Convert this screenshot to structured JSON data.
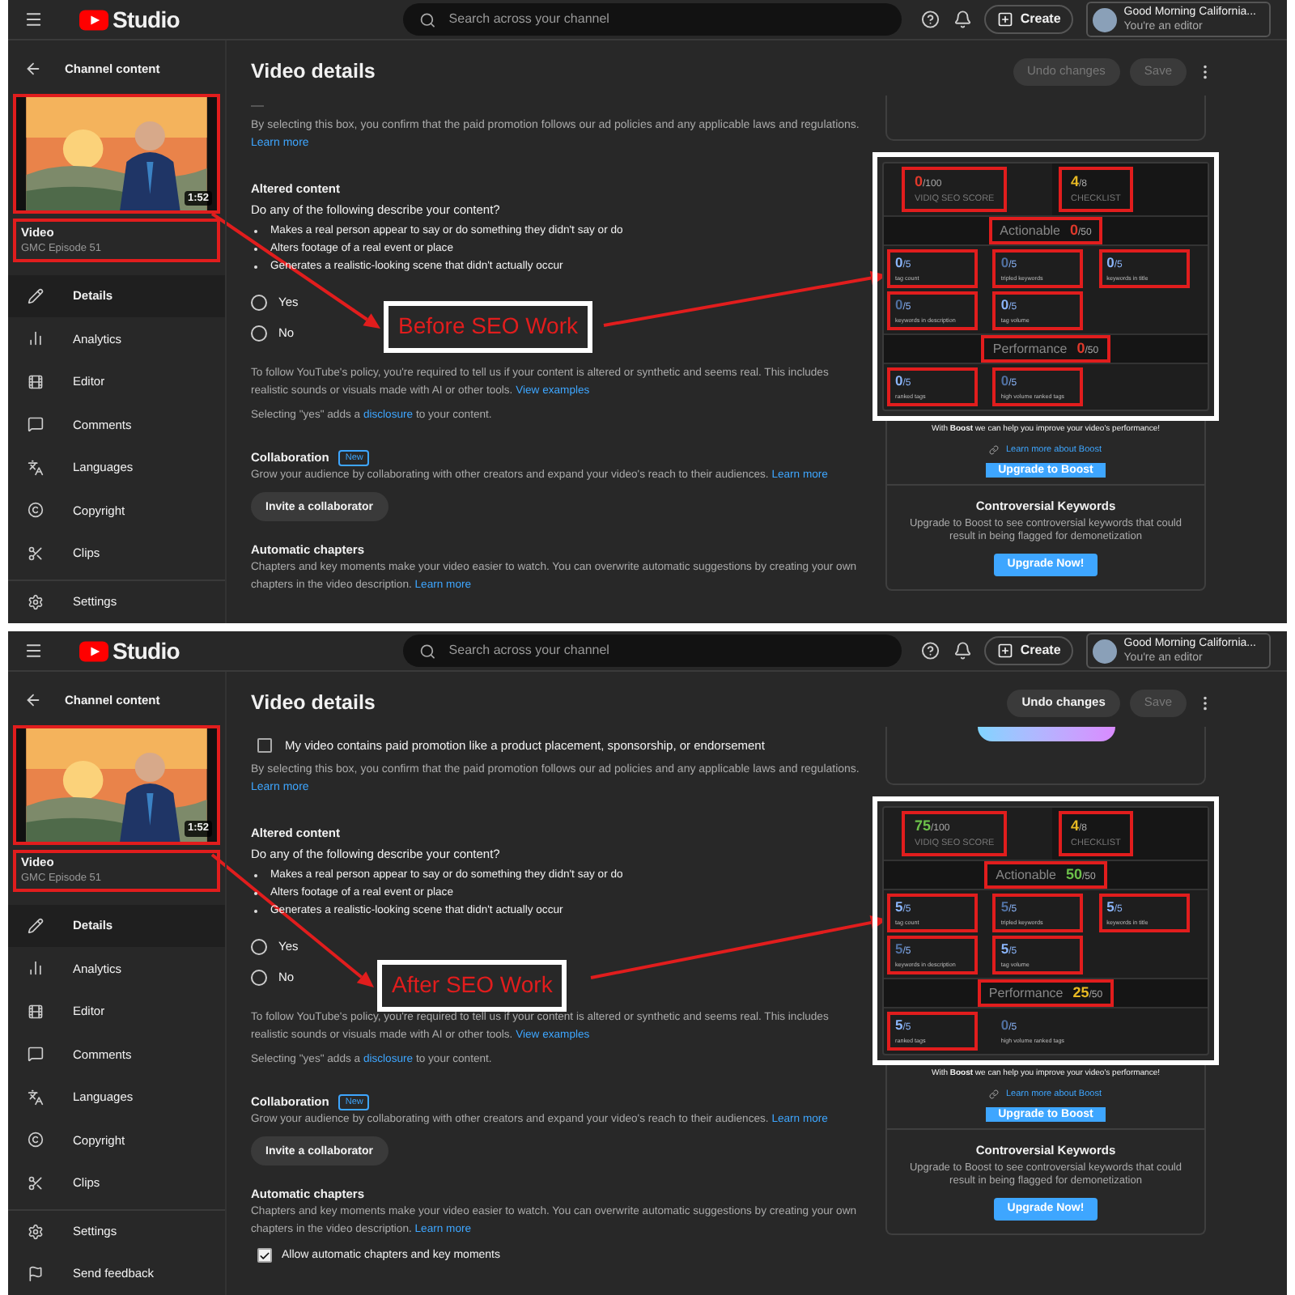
{
  "panels": [
    {
      "header": {
        "logo_text": "Studio",
        "search_placeholder": "Search across your channel",
        "create": "Create",
        "account_name": "Good Morning California...",
        "account_role": "You're an editor"
      },
      "sidebar": {
        "back": "Channel content",
        "duration": "1:52",
        "video_label": "Video",
        "video_name": "GMC Episode 51",
        "items": [
          {
            "label": "Details",
            "selected": true
          },
          {
            "label": "Analytics",
            "selected": false
          },
          {
            "label": "Editor",
            "selected": false
          },
          {
            "label": "Comments",
            "selected": false
          },
          {
            "label": "Languages",
            "selected": false
          },
          {
            "label": "Copyright",
            "selected": false
          },
          {
            "label": "Clips",
            "selected": false
          }
        ],
        "footer_items": [
          {
            "label": "Settings"
          }
        ]
      },
      "main": {
        "title": "Video details",
        "undo": {
          "label": "Undo changes",
          "disabled": true
        },
        "save": {
          "label": "Save",
          "disabled": true
        },
        "paid_note": "By selecting this box, you confirm that the paid promotion follows our ad policies and any applicable laws and regulations.",
        "paid_note_link": "Learn more",
        "altered": {
          "title": "Altered content",
          "question": "Do any of the following describe your content?",
          "bullets": [
            "Makes a real person appear to say or do something they didn't say or do",
            "Alters footage of a real event or place",
            "Generates a realistic-looking scene that didn't actually occur"
          ],
          "options": [
            {
              "label": "Yes",
              "selected": false
            },
            {
              "label": "No",
              "selected": false
            }
          ],
          "policy": "To follow YouTube's policy, you're required to tell us if your content is altered or synthetic and seems real. This includes realistic sounds or visuals made with AI or other tools.",
          "policy_link": "View examples",
          "disclosure_before": "Selecting \"yes\" adds a",
          "disclosure_link": "disclosure",
          "disclosure_after": "to your content."
        },
        "collaboration": {
          "title": "Collaboration",
          "badge": "New",
          "text": "Grow your audience by collaborating with other creators and expand your video's reach to their audiences.",
          "link": "Learn more",
          "button": "Invite a collaborator"
        },
        "chapters": {
          "title": "Automatic chapters",
          "text": "Chapters and key moments make your video easier to watch. You can overwrite automatic suggestions by creating your own chapters in the video description.",
          "link": "Learn more"
        }
      },
      "widget": {
        "top_card": {
          "kind": "card_end"
        },
        "score": {
          "value": "0",
          "total": "/100",
          "label": "VIDIQ SEO SCORE",
          "color": "#e0392b",
          "boxed": true
        },
        "checklist": {
          "value": "4",
          "total": "/8",
          "label": "CHECKLIST",
          "color": "#e8b923",
          "boxed": true
        },
        "sections": [
          {
            "title": "Actionable",
            "value": "0",
            "total": "/50",
            "color": "#e0392b",
            "boxed": true,
            "metrics": [
              {
                "value": "0",
                "total": "/5",
                "label": "tag count",
                "color": "#8ab4f8",
                "boxed": true
              },
              {
                "value": "0",
                "total": "/5",
                "label": "tripled keywords",
                "color": "#4f6f9f",
                "boxed": true
              },
              {
                "value": "0",
                "total": "/5",
                "label": "keywords in title",
                "color": "#8ab4f8",
                "boxed": true
              },
              {
                "value": "0",
                "total": "/5",
                "label": "keywords in description",
                "color": "#4f6f9f",
                "boxed": true
              },
              {
                "value": "0",
                "total": "/5",
                "label": "tag volume",
                "color": "#8ab4f8",
                "boxed": true
              }
            ]
          },
          {
            "title": "Performance",
            "value": "0",
            "total": "/50",
            "color": "#e0392b",
            "boxed": true,
            "metrics": [
              {
                "value": "0",
                "total": "/5",
                "label": "ranked tags",
                "color": "#8ab4f8",
                "boxed": true
              },
              {
                "value": "0",
                "total": "/5",
                "label": "high volume ranked tags",
                "color": "#4f6f9f",
                "boxed": true
              }
            ]
          }
        ],
        "boost_text": "With **Boost** we can help you improve your video's performance!",
        "boost_link": "Learn more about Boost",
        "boost_button": "Upgrade to Boost",
        "controversial_title": "Controversial Keywords",
        "controversial_text": "Upgrade to Boost to see controversial keywords that could result in being flagged for demonetization",
        "upgrade_button": "Upgrade Now!"
      },
      "annotation": {
        "label": "Before SEO Work",
        "highlight_video": true
      }
    },
    {
      "header": {
        "logo_text": "Studio",
        "search_placeholder": "Search across your channel",
        "create": "Create",
        "account_name": "Good Morning California...",
        "account_role": "You're an editor"
      },
      "sidebar": {
        "back": "Channel content",
        "duration": "1:52",
        "video_label": "Video",
        "video_name": "GMC Episode 51",
        "items": [
          {
            "label": "Details",
            "selected": true
          },
          {
            "label": "Analytics",
            "selected": false
          },
          {
            "label": "Editor",
            "selected": false
          },
          {
            "label": "Comments",
            "selected": false
          },
          {
            "label": "Languages",
            "selected": false
          },
          {
            "label": "Copyright",
            "selected": false
          },
          {
            "label": "Clips",
            "selected": false
          }
        ],
        "footer_items": [
          {
            "label": "Settings"
          },
          {
            "label": "Send feedback"
          }
        ]
      },
      "main": {
        "title": "Video details",
        "undo": {
          "label": "Undo changes",
          "disabled": false
        },
        "save": {
          "label": "Save",
          "disabled": true
        },
        "paid_promotion": {
          "label": "My video contains paid promotion like a product placement, sponsorship, or endorsement",
          "checked": false
        },
        "paid_note": "By selecting this box, you confirm that the paid promotion follows our ad policies and any applicable laws and regulations.",
        "paid_note_link": "Learn more",
        "altered": {
          "title": "Altered content",
          "question": "Do any of the following describe your content?",
          "bullets": [
            "Makes a real person appear to say or do something they didn't say or do",
            "Alters footage of a real event or place",
            "Generates a realistic-looking scene that didn't actually occur"
          ],
          "options": [
            {
              "label": "Yes",
              "selected": false
            },
            {
              "label": "No",
              "selected": false
            }
          ],
          "policy": "To follow YouTube's policy, you're required to tell us if your content is altered or synthetic and seems real. This includes realistic sounds or visuals made with AI or other tools.",
          "policy_link": "View examples",
          "disclosure_before": "Selecting \"yes\" adds a",
          "disclosure_link": "disclosure",
          "disclosure_after": "to your content."
        },
        "collaboration": {
          "title": "Collaboration",
          "badge": "New",
          "text": "Grow your audience by collaborating with other creators and expand your video's reach to their audiences.",
          "link": "Learn more",
          "button": "Invite a collaborator"
        },
        "chapters": {
          "title": "Automatic chapters",
          "text": "Chapters and key moments make your video easier to watch. You can overwrite automatic suggestions by creating your own chapters in the video description.",
          "link": "Learn more",
          "checkbox": {
            "label": "Allow automatic chapters and key moments",
            "checked": true
          }
        }
      },
      "widget": {
        "top_card": {
          "kind": "gradient_pill"
        },
        "score": {
          "value": "75",
          "total": "/100",
          "label": "VIDIQ SEO SCORE",
          "color": "#6cc04a",
          "boxed": true
        },
        "checklist": {
          "value": "4",
          "total": "/8",
          "label": "CHECKLIST",
          "color": "#e8b923",
          "boxed": true
        },
        "sections": [
          {
            "title": "Actionable",
            "value": "50",
            "total": "/50",
            "color": "#6cc04a",
            "boxed": true,
            "metrics": [
              {
                "value": "5",
                "total": "/5",
                "label": "tag count",
                "color": "#8ab4f8",
                "boxed": true
              },
              {
                "value": "5",
                "total": "/5",
                "label": "tripled keywords",
                "color": "#4f6f9f",
                "boxed": true
              },
              {
                "value": "5",
                "total": "/5",
                "label": "keywords in title",
                "color": "#8ab4f8",
                "boxed": true
              },
              {
                "value": "5",
                "total": "/5",
                "label": "keywords in description",
                "color": "#4f6f9f",
                "boxed": true
              },
              {
                "value": "5",
                "total": "/5",
                "label": "tag volume",
                "color": "#8ab4f8",
                "boxed": true
              }
            ]
          },
          {
            "title": "Performance",
            "value": "25",
            "total": "/50",
            "color": "#e8b923",
            "boxed": true,
            "metrics": [
              {
                "value": "5",
                "total": "/5",
                "label": "ranked tags",
                "color": "#8ab4f8",
                "boxed": true
              },
              {
                "value": "0",
                "total": "/5",
                "label": "high volume ranked tags",
                "color": "#4f6f9f",
                "boxed": false
              }
            ]
          }
        ],
        "boost_text": "With **Boost** we can help you improve your video's performance!",
        "boost_link": "Learn more about Boost",
        "boost_button": "Upgrade to Boost",
        "controversial_title": "Controversial Keywords",
        "controversial_text": "Upgrade to Boost to see controversial keywords that could result in being flagged for demonetization",
        "upgrade_button": "Upgrade Now!"
      },
      "annotation": {
        "label": "After SEO Work",
        "highlight_video": true
      }
    }
  ]
}
